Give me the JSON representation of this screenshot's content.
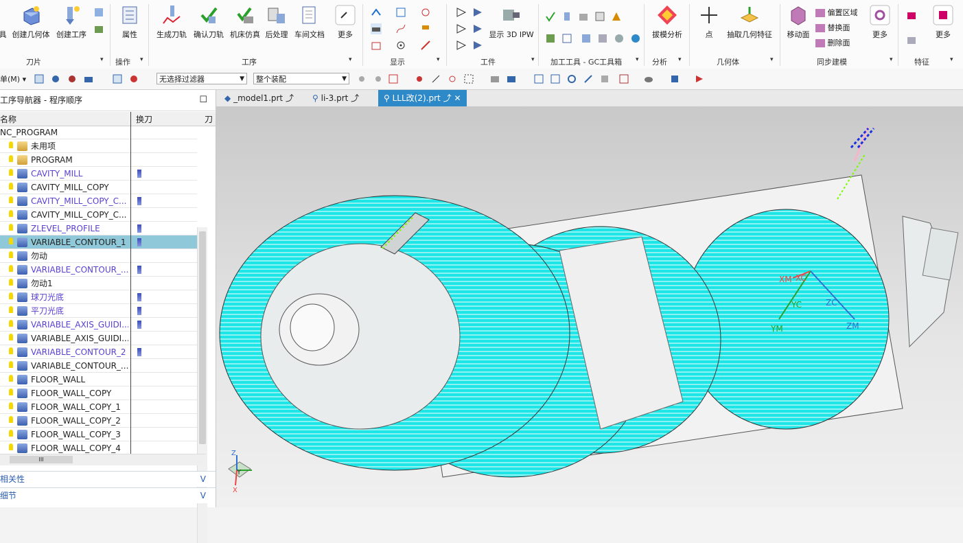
{
  "ribbon": {
    "buttons": [
      {
        "label": "具",
        "x": 0
      },
      {
        "label": "创建几何体"
      },
      {
        "label": "创建工序"
      },
      {
        "label": "属性"
      },
      {
        "label": "生成刀轨"
      },
      {
        "label": "确认刀轨"
      },
      {
        "label": "机床仿真"
      },
      {
        "label": "后处理"
      },
      {
        "label": "车间文档"
      },
      {
        "label": "更多"
      },
      {
        "label": "显示 3D IPW"
      },
      {
        "label": "拔模分析"
      },
      {
        "label": "点"
      },
      {
        "label": "抽取几何特征"
      },
      {
        "label": "移动面"
      },
      {
        "label": "偏置区域"
      },
      {
        "label": "替换面"
      },
      {
        "label": "删除面"
      },
      {
        "label": "更多"
      },
      {
        "label": "更多"
      }
    ],
    "groups": [
      "刀片",
      "操作",
      "工序",
      "显示",
      "工件",
      "加工工具 - GC工具箱",
      "分析",
      "几何体",
      "同步建模",
      "特征"
    ]
  },
  "toolbar": {
    "menu_label": "单(M)",
    "filter_value": "无选择过滤器",
    "assembly_value": "整个装配"
  },
  "navigator": {
    "title": "工序导航器 - 程序顺序",
    "col_name": "名称",
    "col_tool": "换刀",
    "col_extra": "刀",
    "root": "NC_PROGRAM",
    "rows": [
      {
        "name": "未用项",
        "tool": false,
        "blue": false,
        "sel": false
      },
      {
        "name": "PROGRAM",
        "tool": false,
        "blue": false,
        "sel": false
      },
      {
        "name": "CAVITY_MILL",
        "tool": true,
        "blue": true,
        "sel": false
      },
      {
        "name": "CAVITY_MILL_COPY",
        "tool": false,
        "blue": false,
        "sel": false
      },
      {
        "name": "CAVITY_MILL_COPY_C...",
        "tool": true,
        "blue": true,
        "sel": false
      },
      {
        "name": "CAVITY_MILL_COPY_C...",
        "tool": false,
        "blue": false,
        "sel": false
      },
      {
        "name": "ZLEVEL_PROFILE",
        "tool": true,
        "blue": true,
        "sel": false
      },
      {
        "name": "VARIABLE_CONTOUR_1",
        "tool": true,
        "blue": false,
        "sel": true
      },
      {
        "name": "勿动",
        "tool": false,
        "blue": false,
        "sel": false
      },
      {
        "name": "VARIABLE_CONTOUR_...",
        "tool": true,
        "blue": true,
        "sel": false
      },
      {
        "name": "勿动1",
        "tool": false,
        "blue": false,
        "sel": false
      },
      {
        "name": "球刀光底",
        "tool": true,
        "blue": true,
        "sel": false
      },
      {
        "name": "平刀光底",
        "tool": true,
        "blue": true,
        "sel": false
      },
      {
        "name": "VARIABLE_AXIS_GUIDI...",
        "tool": true,
        "blue": true,
        "sel": false
      },
      {
        "name": "VARIABLE_AXIS_GUIDI...",
        "tool": false,
        "blue": false,
        "sel": false
      },
      {
        "name": "VARIABLE_CONTOUR_2",
        "tool": true,
        "blue": true,
        "sel": false
      },
      {
        "name": "VARIABLE_CONTOUR_...",
        "tool": false,
        "blue": false,
        "sel": false
      },
      {
        "name": "FLOOR_WALL",
        "tool": false,
        "blue": false,
        "sel": false
      },
      {
        "name": "FLOOR_WALL_COPY",
        "tool": false,
        "blue": false,
        "sel": false
      },
      {
        "name": "FLOOR_WALL_COPY_1",
        "tool": false,
        "blue": false,
        "sel": false
      },
      {
        "name": "FLOOR_WALL_COPY_2",
        "tool": false,
        "blue": false,
        "sel": false
      },
      {
        "name": "FLOOR_WALL_COPY_3",
        "tool": false,
        "blue": false,
        "sel": false
      },
      {
        "name": "FLOOR_WALL_COPY_4",
        "tool": false,
        "blue": false,
        "sel": false
      }
    ],
    "footer_1": "相关性",
    "footer_2": "细节",
    "hscroll_label": "III"
  },
  "tabs": [
    {
      "label": "_model1.prt",
      "active": false
    },
    {
      "label": "li-3.prt",
      "active": false
    },
    {
      "label": "LLL改(2).prt",
      "active": true
    }
  ],
  "viewport": {
    "axes": {
      "xm": "XM",
      "xc": "XC",
      "yc": "YC",
      "zc": "ZC",
      "ym": "YM",
      "zm": "ZM"
    },
    "triad": {
      "z": "Z",
      "y": "Y",
      "x": "X"
    }
  },
  "colors": {
    "accent": "#2e89c9",
    "toolpath": "#1ee6e6",
    "selected_row": "#8fc8d8"
  }
}
